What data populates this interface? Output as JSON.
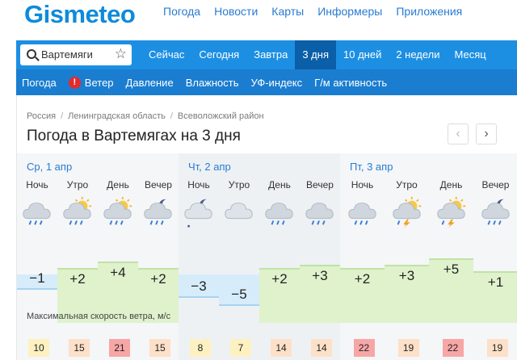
{
  "header": {
    "logo": "Gismeteo",
    "nav": [
      "Погода",
      "Новости",
      "Карты",
      "Информеры",
      "Приложения"
    ]
  },
  "search": {
    "value": "Вартемяги",
    "icon": "search-icon",
    "fav_icon": "star-icon"
  },
  "tabs": [
    {
      "label": "Сейчас",
      "active": false
    },
    {
      "label": "Сегодня",
      "active": false
    },
    {
      "label": "Завтра",
      "active": false
    },
    {
      "label": "3 дня",
      "active": true
    },
    {
      "label": "10 дней",
      "active": false
    },
    {
      "label": "2 недели",
      "active": false
    },
    {
      "label": "Месяц",
      "active": false
    }
  ],
  "subnav": [
    "Погода",
    "Ветер",
    "Давление",
    "Влажность",
    "УФ-индекс",
    "Г/м активность"
  ],
  "breadcrumb": [
    "Россия",
    "Ленинградская область",
    "Всеволожский район"
  ],
  "page_title": "Погода в Вартемягах на 3 дня",
  "nav_arrows": {
    "prev": "‹",
    "next": "›"
  },
  "days": [
    {
      "label": "Ср, 1 апр"
    },
    {
      "label": "Чт, 2 апр"
    },
    {
      "label": "Пт, 3 апр"
    }
  ],
  "slots": [
    {
      "label": "Ночь",
      "icon": "cloud-rain-icon",
      "temp": "−1",
      "temp_value": -1,
      "wind": "10"
    },
    {
      "label": "Утро",
      "icon": "sun-cloud-rain-icon",
      "temp": "+2",
      "temp_value": 2,
      "wind": "15"
    },
    {
      "label": "День",
      "icon": "sun-cloud-rain-icon",
      "temp": "+4",
      "temp_value": 4,
      "wind": "21"
    },
    {
      "label": "Вечер",
      "icon": "moon-cloud-rain-icon",
      "temp": "+2",
      "temp_value": 2,
      "wind": "15"
    },
    {
      "label": "Ночь",
      "icon": "moon-cloud-icon",
      "temp": "−3",
      "temp_value": -3,
      "wind": "8"
    },
    {
      "label": "Утро",
      "icon": "cloud-icon",
      "temp": "−5",
      "temp_value": -5,
      "wind": "7"
    },
    {
      "label": "День",
      "icon": "cloud-rain-icon",
      "temp": "+2",
      "temp_value": 2,
      "wind": "14"
    },
    {
      "label": "Вечер",
      "icon": "cloud-rain-icon",
      "temp": "+3",
      "temp_value": 3,
      "wind": "14"
    },
    {
      "label": "Ночь",
      "icon": "cloud-rain-icon",
      "temp": "+2",
      "temp_value": 2,
      "wind": "22"
    },
    {
      "label": "Утро",
      "icon": "sun-cloud-storm-icon",
      "temp": "+3",
      "temp_value": 3,
      "wind": "19"
    },
    {
      "label": "День",
      "icon": "sun-cloud-storm-icon",
      "temp": "+5",
      "temp_value": 5,
      "wind": "22"
    },
    {
      "label": "Вечер",
      "icon": "moon-cloud-rain-icon",
      "temp": "+1",
      "temp_value": 1,
      "wind": "19"
    }
  ],
  "wind_label": "Максимальная скорость ветра, м/с",
  "colors": {
    "accent": "#1c8fe3",
    "accent_dark": "#0b5fa8",
    "link": "#2a7bd3",
    "warm_temp": "#dff2cc",
    "cold_temp": "#d6ecfa",
    "wind_low": "#fdf1c2",
    "wind_mid": "#fde0c8",
    "wind_high": "#f7a6a6"
  }
}
